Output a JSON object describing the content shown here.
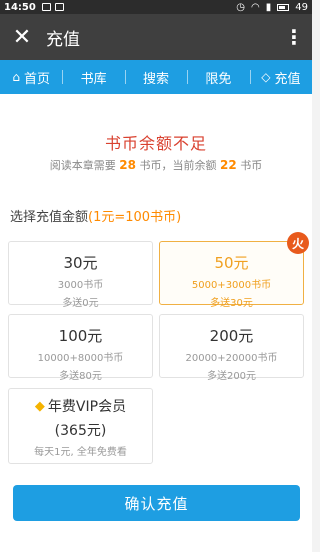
{
  "status_bar": {
    "time": "14:50",
    "battery": "49"
  },
  "app_bar": {
    "title": "充值"
  },
  "nav": {
    "items": [
      {
        "label": "首页",
        "icon": "home-icon"
      },
      {
        "label": "书库"
      },
      {
        "label": "搜索"
      },
      {
        "label": "限免"
      },
      {
        "label": "充值",
        "icon": "diamond-icon"
      }
    ]
  },
  "notice": {
    "title": "书币余额不足",
    "prefix": "阅读本章需要",
    "needed": "28",
    "mid": "书币，当前余额",
    "balance": "22",
    "suffix": "书币"
  },
  "choose": {
    "label": "选择充值金额",
    "rate": "(1元=100书币)"
  },
  "options": [
    {
      "amount": "30元",
      "coins": "3000书币",
      "bonus": "多送0元"
    },
    {
      "amount": "50元",
      "coins": "5000+3000书币",
      "bonus": "多送30元",
      "badge": "火"
    },
    {
      "amount": "100元",
      "coins": "10000+8000书币",
      "bonus": "多送80元"
    },
    {
      "amount": "200元",
      "coins": "20000+20000书币",
      "bonus": "多送200元"
    }
  ],
  "vip": {
    "title": "年费VIP会员",
    "price": "(365元)",
    "desc": "每天1元, 全年免费看"
  },
  "confirm_label": "确认充值",
  "colors": {
    "accent": "#1e9ee2",
    "warning": "#d9412f",
    "highlight": "#ff8a00"
  }
}
